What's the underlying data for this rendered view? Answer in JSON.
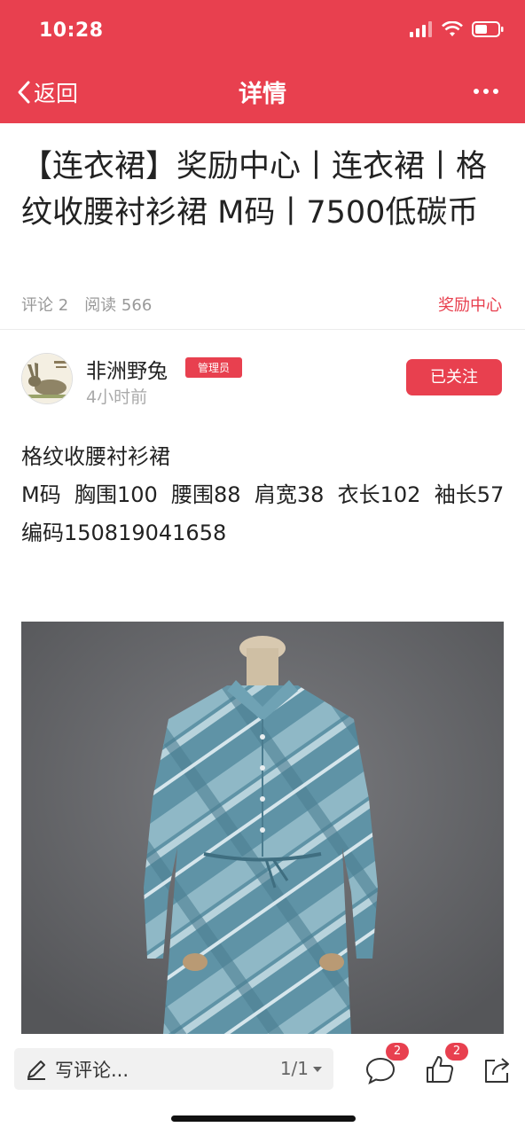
{
  "status": {
    "time": "10:28"
  },
  "nav": {
    "back_label": "返回",
    "title": "详情"
  },
  "post": {
    "title": "【连衣裙】奖励中心丨连衣裙丨格纹收腰衬衫裙 M码丨7500低碳币",
    "comments_label": "评论 2",
    "reads_label": "阅读 566",
    "category": "奖励中心"
  },
  "author": {
    "name": "非洲野兔",
    "badge": "管理员",
    "time": "4小时前",
    "follow_label": "已关注"
  },
  "content": {
    "line1": "格纹收腰衬衫裙",
    "line2": "M码  胸围100  腰围88  肩宽38  衣长102  袖长57  编码150819041658"
  },
  "bottom": {
    "comment_placeholder": "写评论...",
    "pager": "1/1",
    "comment_count": "2",
    "like_count": "2"
  },
  "icons": [
    "chevron-left-icon",
    "more-icon",
    "pencil-icon",
    "caret-down-icon",
    "comment-icon",
    "thumbs-up-icon",
    "share-icon",
    "signal-icon",
    "wifi-icon",
    "battery-icon"
  ],
  "colors": {
    "accent": "#e8404f",
    "muted": "#999999",
    "image_bg": "#6b6c70",
    "dress": "#5f93a6"
  }
}
